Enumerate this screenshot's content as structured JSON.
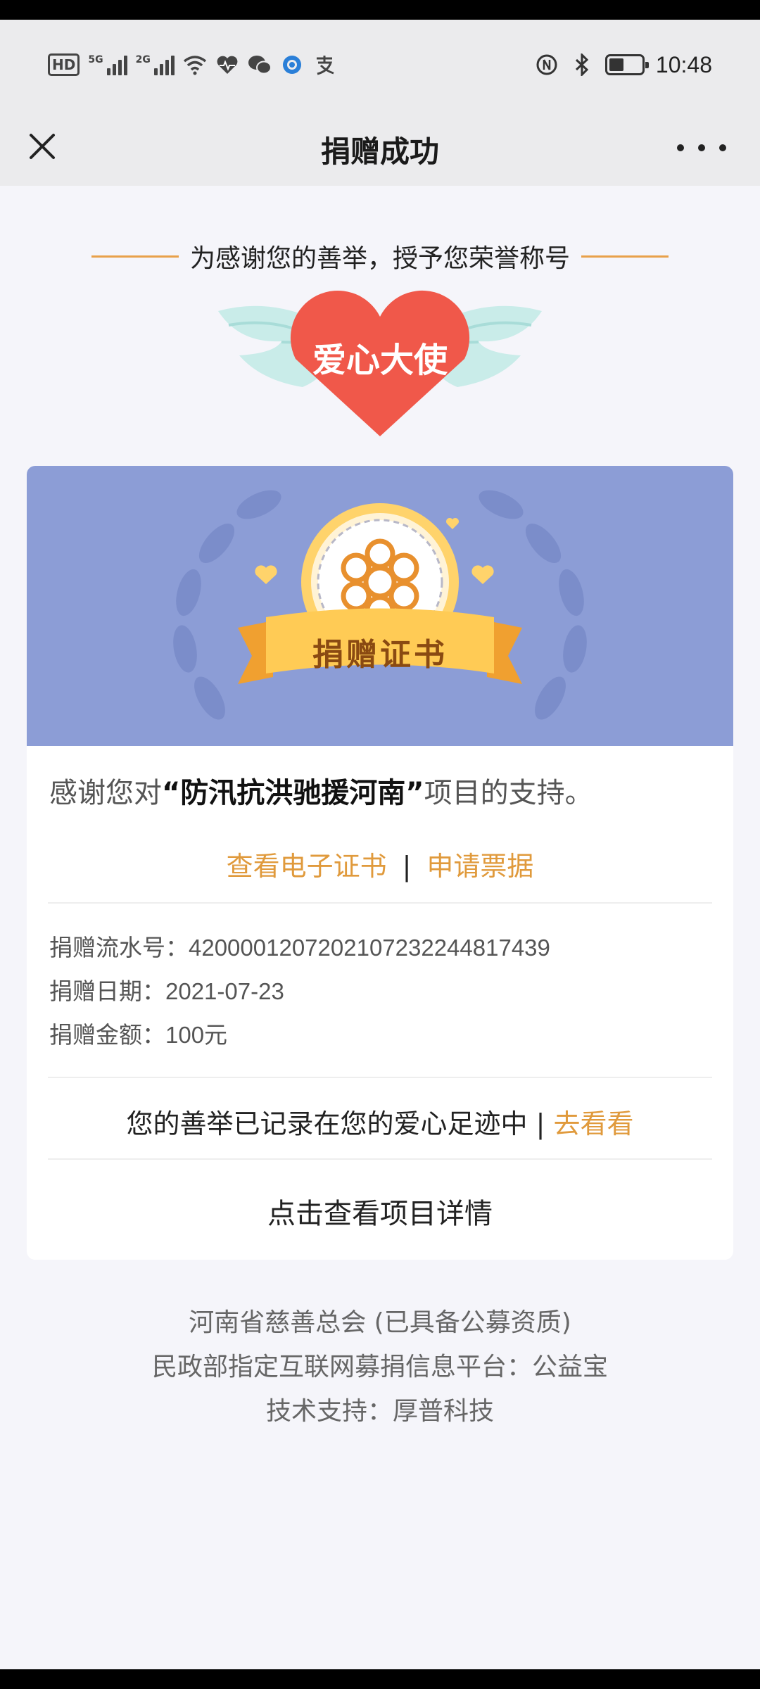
{
  "status_bar": {
    "hd_label": "HD",
    "net1_label": "5G",
    "net2_label": "2G",
    "time": "10:48",
    "battery_level": 0.45,
    "icons": [
      "wifi-icon",
      "heart-health-icon",
      "wechat-icon",
      "browser-icon",
      "alipay-icon",
      "nfc-icon",
      "bluetooth-icon"
    ]
  },
  "nav": {
    "title": "捐赠成功"
  },
  "honor": {
    "caption": "为感谢您的善举，授予您荣誉称号",
    "title": "爱心大使"
  },
  "certificate": {
    "banner_label": "捐赠证书",
    "thanks_prefix": "感谢您对",
    "project_name": "“防汛抗洪驰援河南”",
    "thanks_suffix": "项目的支持。",
    "view_certificate": "查看电子证书",
    "link_separator": "|",
    "apply_receipt": "申请票据",
    "serial_label": "捐赠流水号：",
    "serial_value": "42000012072021072322448174 39",
    "date_label": "捐赠日期：",
    "date_value": "2021-07-23",
    "amount_label": "捐赠金额：",
    "amount_value": "100元",
    "footprint_text": "您的善举已记录在您的爱心足迹中 | ",
    "footprint_link": "去看看",
    "project_detail": "点击查看项目详情"
  },
  "footer": {
    "line1": "河南省慈善总会 (已具备公募资质)",
    "line2": "民政部指定互联网募捐信息平台：公益宝",
    "line3": "技术支持：厚普科技"
  },
  "colors": {
    "accent": "#e09a3c",
    "banner": "#8c9dd6",
    "heart": "#f0584a",
    "background": "#f5f5fa"
  }
}
